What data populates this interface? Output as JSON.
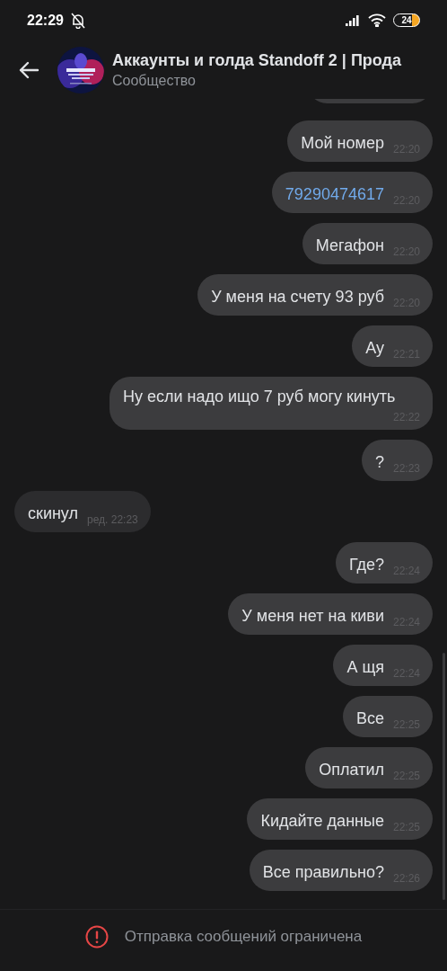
{
  "status_bar": {
    "time": "22:29",
    "battery": "24"
  },
  "header": {
    "title": "Аккаунты и голда Standoff 2 | Прода",
    "subtitle": "Сообщество"
  },
  "messages_above": true,
  "messages": [
    {
      "outgoing": true,
      "kind": "text",
      "text": "Мой номер",
      "time": "22:20"
    },
    {
      "outgoing": true,
      "kind": "link",
      "text": "79290474617",
      "time": "22:20"
    },
    {
      "outgoing": true,
      "kind": "text",
      "text": "Мегафон",
      "time": "22:20"
    },
    {
      "outgoing": true,
      "kind": "text",
      "text": "У меня на счету 93 руб",
      "time": "22:20"
    },
    {
      "outgoing": true,
      "kind": "text",
      "text": "Ау",
      "time": "22:21"
    },
    {
      "outgoing": true,
      "kind": "text",
      "text": "Ну если надо ищо 7 руб могу кинуть",
      "time": "22:22"
    },
    {
      "outgoing": true,
      "kind": "text",
      "text": "?",
      "time": "22:23"
    },
    {
      "outgoing": false,
      "kind": "text",
      "text": "скинул",
      "time": "ред. 22:23"
    },
    {
      "outgoing": true,
      "kind": "text",
      "text": "Где?",
      "time": "22:24"
    },
    {
      "outgoing": true,
      "kind": "text",
      "text": "У меня нет на киви",
      "time": "22:24"
    },
    {
      "outgoing": true,
      "kind": "text",
      "text": "А щя",
      "time": "22:24"
    },
    {
      "outgoing": true,
      "kind": "text",
      "text": "Все",
      "time": "22:25"
    },
    {
      "outgoing": true,
      "kind": "text",
      "text": "Оплатил",
      "time": "22:25"
    },
    {
      "outgoing": true,
      "kind": "text",
      "text": "Кидайте данные",
      "time": "22:25"
    },
    {
      "outgoing": true,
      "kind": "text",
      "text": "Все правильно?",
      "time": "22:26"
    }
  ],
  "footer": {
    "notice": "Отправка сообщений ограничена"
  }
}
